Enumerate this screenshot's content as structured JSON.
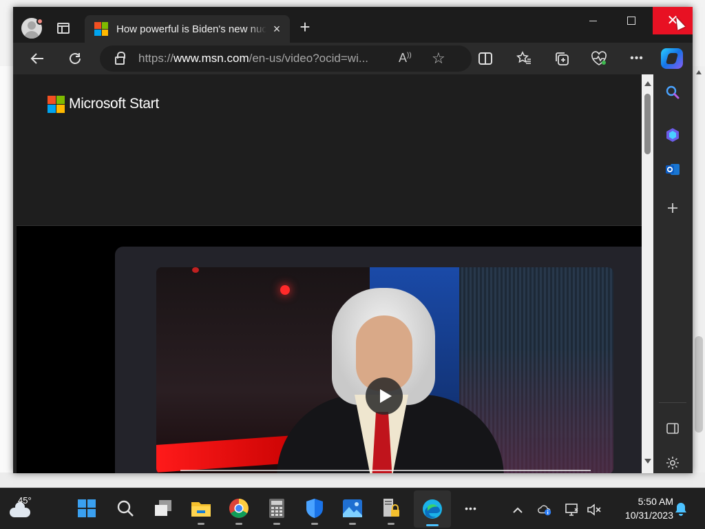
{
  "browser": {
    "tab_title": "How powerful is Biden's new nuclear bomb?",
    "new_tab_symbol": "+",
    "tab_close_symbol": "×",
    "address": {
      "prefix": "https://",
      "host": "www.msn.com",
      "path": "/en-us/video?ocid=wi..."
    },
    "window_close_symbol": "✕"
  },
  "page": {
    "brand_name": "Microsoft Start",
    "ms_logo_colors": [
      "#f25022",
      "#7fba00",
      "#00a4ef",
      "#ffb900"
    ]
  },
  "taskbar": {
    "weather_temp": "45°",
    "time": "5:50 AM",
    "date": "10/31/2023",
    "more_symbol": "•••"
  },
  "colors": {
    "close_button": "#e81123",
    "active_indicator": "#4cc2ff"
  }
}
